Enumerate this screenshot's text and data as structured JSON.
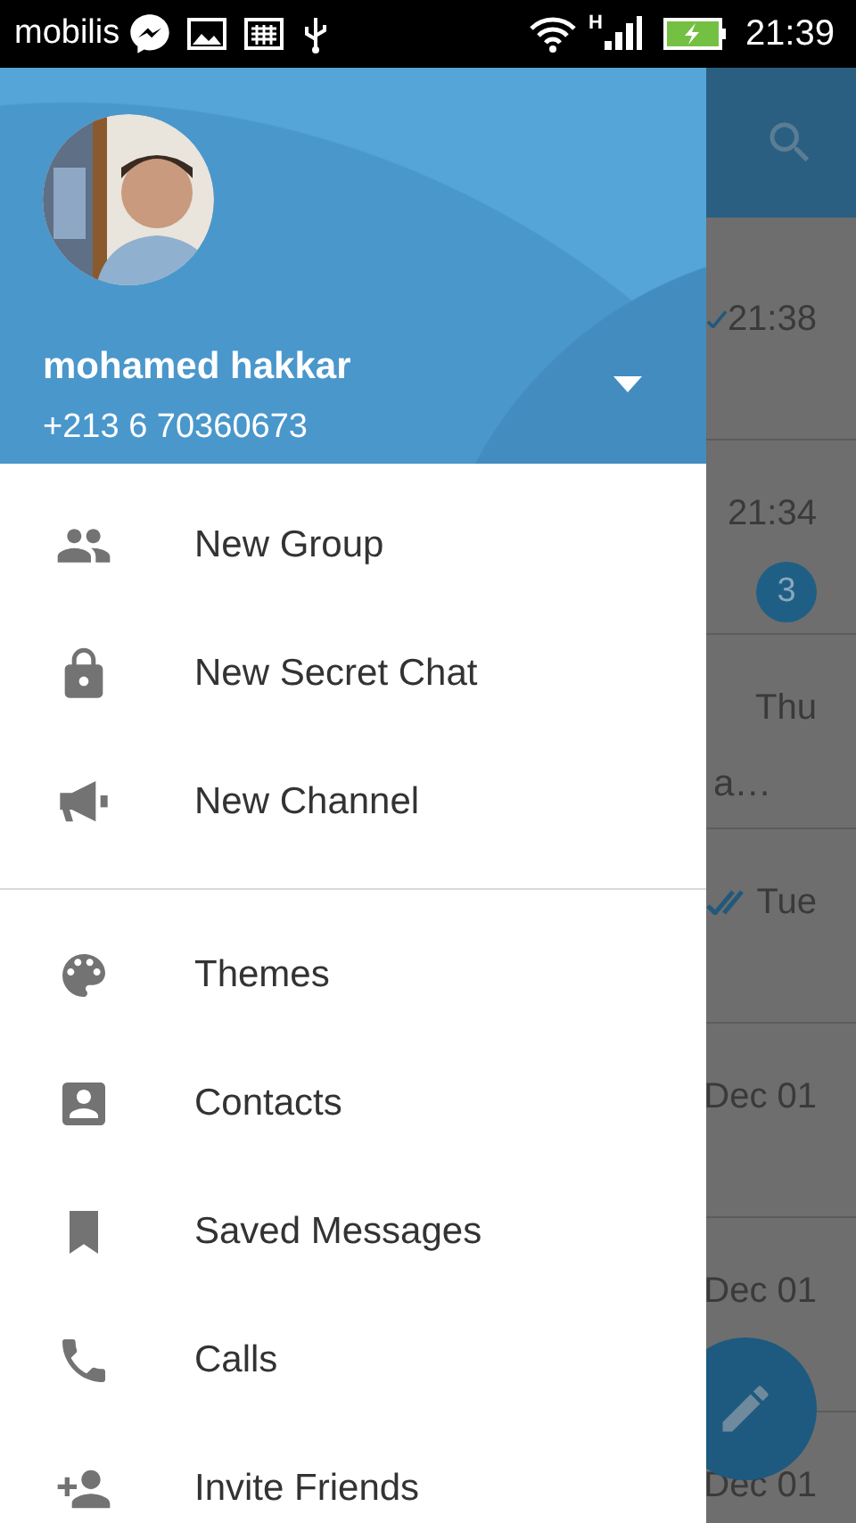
{
  "status_bar": {
    "carrier": "mobilis",
    "network_type": "H",
    "time": "21:39"
  },
  "drawer": {
    "profile": {
      "name": "mohamed hakkar",
      "phone": "+213 6 70360673"
    },
    "sections": [
      [
        {
          "label": "New Group"
        },
        {
          "label": "New Secret Chat"
        },
        {
          "label": "New Channel"
        }
      ],
      [
        {
          "label": "Themes"
        },
        {
          "label": "Contacts"
        },
        {
          "label": "Saved Messages"
        },
        {
          "label": "Calls"
        },
        {
          "label": "Invite Friends"
        }
      ]
    ]
  },
  "chat_list": {
    "rows": [
      {
        "kind": "sent",
        "time": "21:38"
      },
      {
        "kind": "plain",
        "time": "21:34",
        "badge": "3"
      },
      {
        "kind": "plain",
        "time": "Thu",
        "snippet": "a…"
      },
      {
        "kind": "read",
        "time": "Tue"
      },
      {
        "kind": "plain",
        "time": "Dec 01"
      },
      {
        "kind": "plain",
        "time": "Dec 01"
      },
      {
        "kind": "plain",
        "time": "Dec 01"
      }
    ]
  }
}
